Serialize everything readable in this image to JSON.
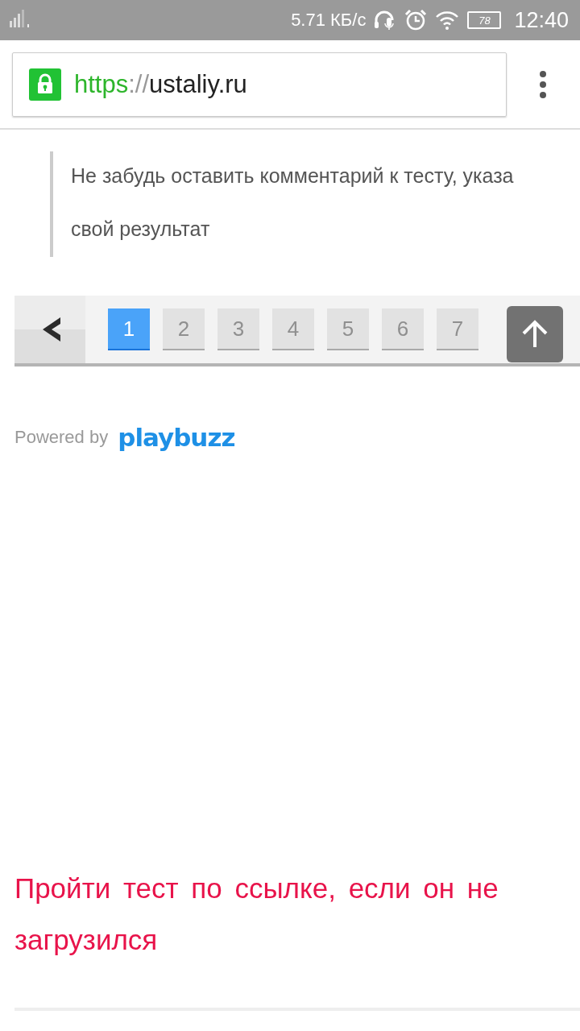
{
  "status_bar": {
    "speed": "5.71 КБ/с",
    "battery": "78",
    "time": "12:40"
  },
  "address_bar": {
    "scheme": "https",
    "separator": "://",
    "host": "ustaliy.ru",
    "secure": true
  },
  "quote": {
    "lines": [
      "Не забудь оставить комментарий к тесту, указа",
      "свой результат"
    ]
  },
  "pagination": {
    "pages": [
      {
        "label": "1",
        "selected": true
      },
      {
        "label": "2",
        "selected": false
      },
      {
        "label": "3",
        "selected": false
      },
      {
        "label": "4",
        "selected": false
      },
      {
        "label": "5",
        "selected": false
      },
      {
        "label": "6",
        "selected": false
      },
      {
        "label": "7",
        "selected": false
      }
    ]
  },
  "powered_by": {
    "label": "Powered by",
    "brand": "playbuzz"
  },
  "link": "Пройти тест по ссылке, если он не загрузился"
}
